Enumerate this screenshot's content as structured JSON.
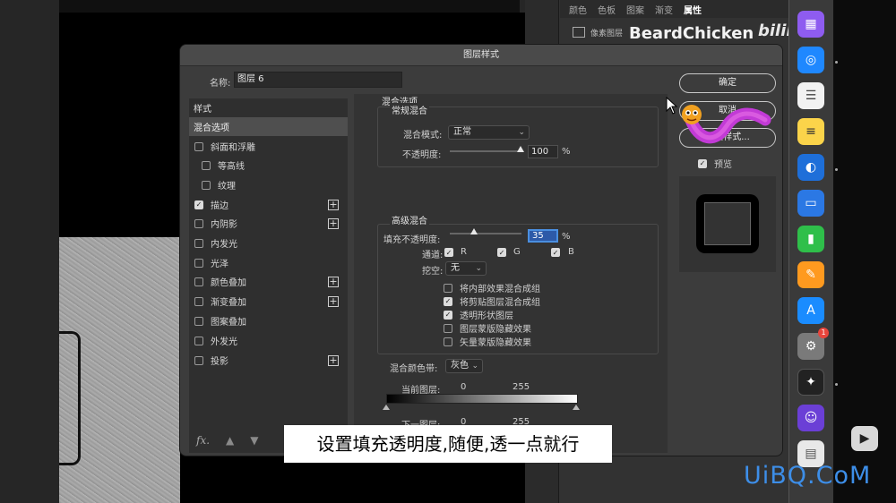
{
  "panel_tabs": [
    "颜色",
    "色板",
    "图案",
    "渐变",
    "属性"
  ],
  "layer_row_text": "像素图层",
  "watermark": "BeardChicken",
  "bili_logo": "bilibili",
  "dialog": {
    "title": "图层样式",
    "name_label": "名称:",
    "name_value": "图层 6",
    "style_list": {
      "header": "样式",
      "selected": "混合选项",
      "items": [
        {
          "label": "斜面和浮雕",
          "checked": false,
          "indent": false,
          "plus": false
        },
        {
          "label": "等高线",
          "checked": false,
          "indent": true,
          "plus": false
        },
        {
          "label": "纹理",
          "checked": false,
          "indent": true,
          "plus": false
        },
        {
          "label": "描边",
          "checked": true,
          "indent": false,
          "plus": true
        },
        {
          "label": "内阴影",
          "checked": false,
          "indent": false,
          "plus": true
        },
        {
          "label": "内发光",
          "checked": false,
          "indent": false,
          "plus": false
        },
        {
          "label": "光泽",
          "checked": false,
          "indent": false,
          "plus": false
        },
        {
          "label": "颜色叠加",
          "checked": false,
          "indent": false,
          "plus": true
        },
        {
          "label": "渐变叠加",
          "checked": false,
          "indent": false,
          "plus": true
        },
        {
          "label": "图案叠加",
          "checked": false,
          "indent": false,
          "plus": false
        },
        {
          "label": "外发光",
          "checked": false,
          "indent": false,
          "plus": false
        },
        {
          "label": "投影",
          "checked": false,
          "indent": false,
          "plus": true
        }
      ],
      "fx_label": "fx."
    },
    "blend": {
      "section_title": "混合选项",
      "general_title": "常规混合",
      "mode_label": "混合模式:",
      "mode_value": "正常",
      "opacity_label": "不透明度:",
      "opacity_value": "100",
      "percent": "%",
      "advanced_title": "高级混合",
      "fill_label": "填充不透明度:",
      "fill_value": "35",
      "channels_label": "通道:",
      "channel_r": "R",
      "channel_g": "G",
      "channel_b": "B",
      "knockout_label": "挖空:",
      "knockout_value": "无",
      "options": [
        {
          "label": "将内部效果混合成组",
          "checked": false
        },
        {
          "label": "将剪贴图层混合成组",
          "checked": true
        },
        {
          "label": "透明形状图层",
          "checked": true
        },
        {
          "label": "图层蒙版隐藏效果",
          "checked": false
        },
        {
          "label": "矢量蒙版隐藏效果",
          "checked": false
        }
      ],
      "blend_if_label": "混合颜色带:",
      "blend_if_value": "灰色",
      "this_layer_label": "当前图层:",
      "this_layer_low": "0",
      "this_layer_high": "255",
      "under_layer_label": "下一图层:",
      "under_layer_low": "0",
      "under_layer_high": "255"
    },
    "buttons": {
      "ok": "确定",
      "cancel": "取消",
      "new_style": "新建样式...",
      "preview_label": "预览"
    }
  },
  "subtitle": "设置填充透明度,随便,透一点就行",
  "dock_badge": "1",
  "site_watermark": "UiBQ.CoM",
  "colors": {
    "dialog_bg": "#3c3c3c",
    "accent_focus": "#4a8fe0"
  }
}
